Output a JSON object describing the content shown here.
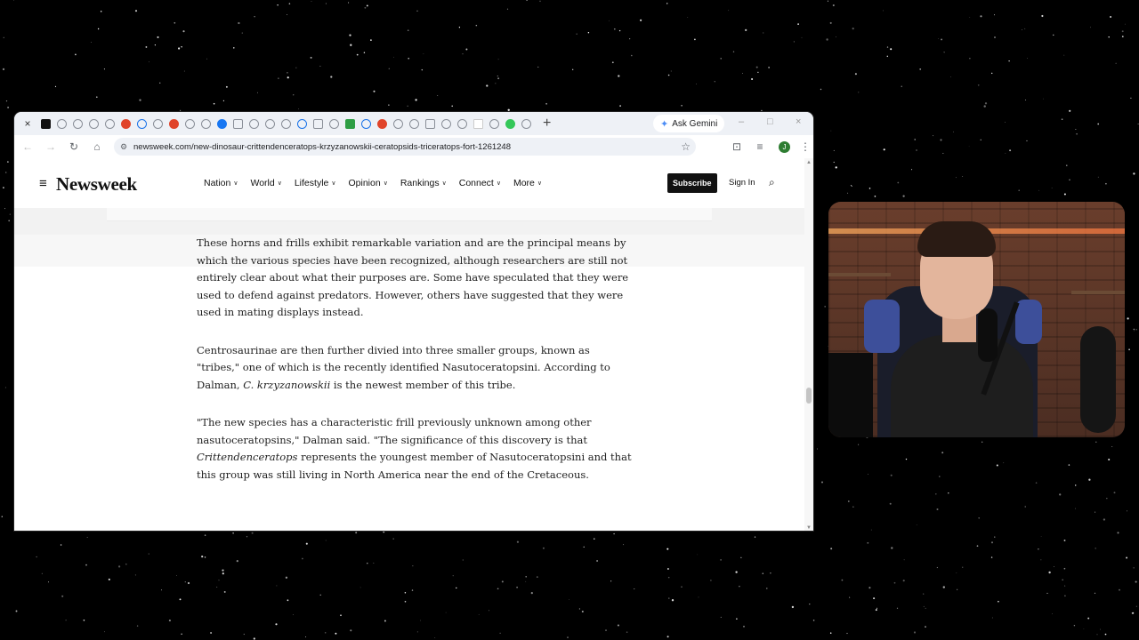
{
  "browser": {
    "tab_close_glyph": "×",
    "new_tab_glyph": "+",
    "ask_gemini": "Ask Gemini",
    "url": "newsweek.com/new-dinosaur-crittendenceratops-krzyzanowskii-ceratopsids-triceratops-fort-1261248",
    "avatar_initial": "J",
    "window_controls": [
      "–",
      "□",
      "×"
    ]
  },
  "site": {
    "logo": "Newsweek",
    "nav": [
      "Nation",
      "World",
      "Lifestyle",
      "Opinion",
      "Rankings",
      "Connect",
      "More"
    ],
    "subscribe": "Subscribe",
    "sign_in": "Sign In"
  },
  "article": {
    "p1": "These horns and frills exhibit remarkable variation and are the principal means by which the various species have been recognized, although researchers are still not entirely clear about what their purposes are. Some have speculated that they were used to defend against predators. However, others have suggested that they were used in mating displays instead.",
    "p2_a": "Centrosaurinae are then further divied into three smaller groups, known as \"tribes,\" one of which is the recently identified Nasutoceratopsini. According to Dalman, ",
    "p2_em": "C. krzyzanowskii",
    "p2_b": " is the newest member of this tribe.",
    "p3_a": "\"The new species has a characteristic frill previously unknown among other nasutoceratopsins,\" Dalman said. \"The significance of this discovery is that ",
    "p3_em": "Crittendenceratops",
    "p3_b": " represents the youngest member of Nasutoceratopsini and that this group was still living in North America near the end of the Cretaceous."
  }
}
